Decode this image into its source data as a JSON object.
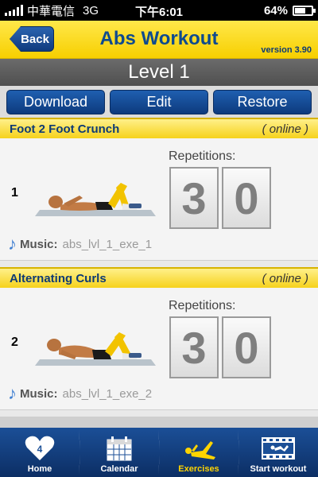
{
  "status_bar": {
    "carrier": "中華電信",
    "network": "3G",
    "time": "下午6:01",
    "battery": "64%",
    "battery_level": 0.64
  },
  "header": {
    "back_label": "Back",
    "title": "Abs Workout",
    "version": "version 3.90"
  },
  "level": {
    "title": "Level 1"
  },
  "actions": {
    "download_label": "Download",
    "edit_label": "Edit",
    "restore_label": "Restore"
  },
  "exercises": [
    {
      "name": "Foot 2 Foot Crunch",
      "status": "( online )",
      "number": "1",
      "reps_label": "Repetitions:",
      "reps_digit_1": "3",
      "reps_digit_2": "0",
      "music_label": "Music:",
      "music_value": "abs_lvl_1_exe_1"
    },
    {
      "name": "Alternating Curls",
      "status": "( online )",
      "number": "2",
      "reps_label": "Repetitions:",
      "reps_digit_1": "3",
      "reps_digit_2": "0",
      "music_label": "Music:",
      "music_value": "abs_lvl_1_exe_2"
    }
  ],
  "tabs": [
    {
      "label": "Home",
      "icon": "home-logo-icon",
      "active": false
    },
    {
      "label": "Calendar",
      "icon": "calendar-icon",
      "active": false
    },
    {
      "label": "Exercises",
      "icon": "exercise-icon",
      "active": true
    },
    {
      "label": "Start workout",
      "icon": "start-workout-icon",
      "active": false
    }
  ],
  "colors": {
    "header_yellow": "#f7cf00",
    "brand_blue": "#0e4a8f",
    "active_tab": "#ffd400",
    "tab_bar_blue": "#1b4f97"
  }
}
